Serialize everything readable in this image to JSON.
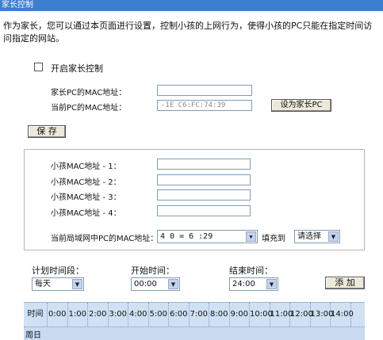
{
  "title": "家长控制",
  "intro": "作为家长，您可以通过本页面进行设置，控制小孩的上网行为，使得小孩的PC只能在指定时间访问指定的网站。",
  "enable": {
    "label": "开启家长控制"
  },
  "parent_pc_mac": {
    "label": "家长PC的MAC地址：",
    "value": ""
  },
  "current_pc_mac": {
    "label": "当前PC的MAC地址：",
    "value": "-1E C6:FC:74:39",
    "button": "设为家长PC"
  },
  "save_button": "保 存",
  "child_macs": [
    {
      "label": "小孩MAC地址 - 1：",
      "value": ""
    },
    {
      "label": "小孩MAC地址 - 2：",
      "value": ""
    },
    {
      "label": "小孩MAC地址 - 3：",
      "value": ""
    },
    {
      "label": "小孩MAC地址 - 4：",
      "value": ""
    }
  ],
  "lan_pc_mac": {
    "label": "当前局域网中PC的MAC地址：",
    "value": "4 0 = 6 :29",
    "fill_label": "填充到",
    "fill_select": "请选择"
  },
  "schedule": {
    "period_label": "计划时间段：",
    "period_value": "每天",
    "start_label": "开始时间：",
    "start_value": "00:00",
    "end_label": "结束时间：",
    "end_value": "24:00",
    "add_button": "添 加",
    "time_header": "时间",
    "day_label": "周日",
    "hours": [
      "0:00",
      "1:00",
      "2:00",
      "3:00",
      "4:00",
      "5:00",
      "6:00",
      "7:00",
      "8:00",
      "9:00",
      "10:00",
      "11:00",
      "12:00",
      "13:00",
      "14:00"
    ]
  }
}
